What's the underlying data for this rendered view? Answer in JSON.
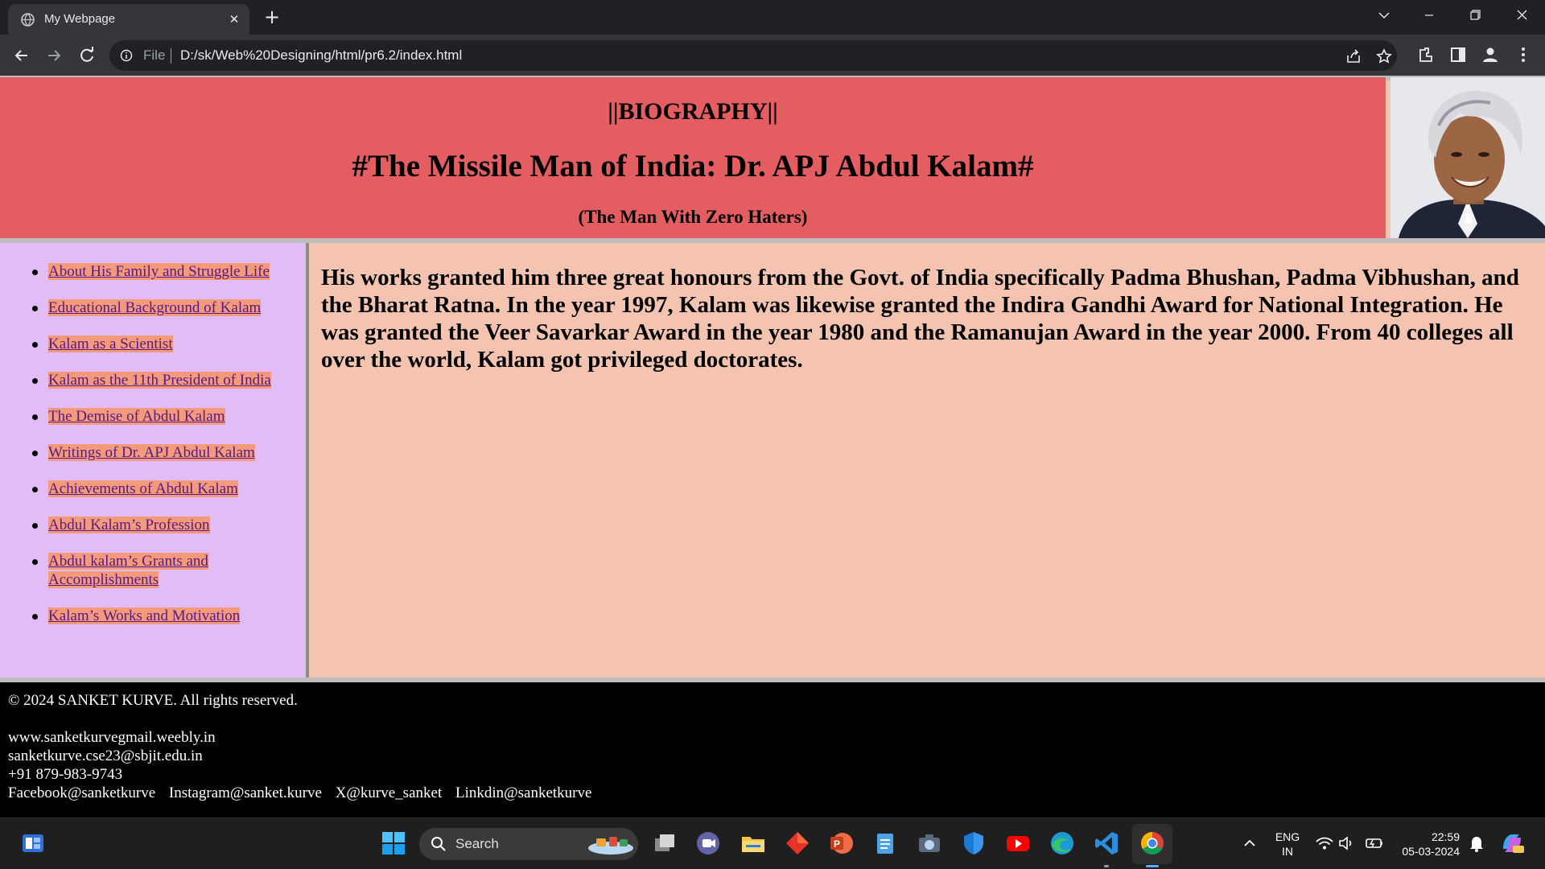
{
  "browser": {
    "tab_title": "My Webpage",
    "tab_close": "✕",
    "new_tab": "+",
    "url_scheme": "File",
    "url": "D:/sk/Web%20Designing/html/pr6.2/index.html"
  },
  "header": {
    "subtitle": "||BIOGRAPHY||",
    "title": "#The Missile Man of India: Dr. APJ Abdul Kalam#",
    "tagline": "(The Man With Zero Haters)"
  },
  "sidebar": {
    "links": [
      "About His Family and Struggle Life",
      "Educational Background of Kalam",
      "Kalam as a Scientist",
      "Kalam as the 11th President of India",
      "The Demise of Abdul Kalam",
      "Writings of Dr. APJ Abdul Kalam",
      "Achievements of Abdul Kalam",
      "Abdul Kalam’s Profession",
      "Abdul kalam’s Grants and Accomplishments",
      "Kalam’s Works and Motivation"
    ]
  },
  "main": {
    "text": "His works granted him three great honours from the Govt. of India specifically Padma Bhushan, Padma Vibhushan, and the Bharat Ratna. In the year 1997, Kalam was likewise granted the Indira Gandhi Award for National Integration. He was granted the Veer Savarkar Award in the year 1980 and the Ramanujan Award in the year 2000. From 40 colleges all over the world, Kalam got privileged doctorates."
  },
  "footer": {
    "copyright": "© 2024 SANKET KURVE. All rights reserved.",
    "website": "www.sanketkurvegmail.weebly.in",
    "email": "sanketkurve.cse23@sbjit.edu.in",
    "phone": "+91 879-983-9743",
    "social": {
      "facebook": "Facebook@sanketkurve",
      "instagram": "Instagram@sanket.kurve",
      "x": "X@kurve_sanket",
      "linkedin": "Linkdin@sanketkurve"
    }
  },
  "taskbar": {
    "search_label": "Search",
    "language": "ENG",
    "region": "IN",
    "time": "22:59",
    "date": "05-03-2024"
  },
  "icons": {
    "tab": "globe-icon",
    "nav": [
      "back-icon",
      "forward-icon",
      "reload-icon"
    ],
    "omnibox": [
      "info-icon",
      "share-icon",
      "star-icon"
    ],
    "toolbar": [
      "extensions-icon",
      "side-panel-icon",
      "profile-icon",
      "menu-icon"
    ],
    "taskbar": [
      "widgets-icon",
      "windows-start-icon",
      "search-icon",
      "task-view-icon",
      "teams-icon",
      "file-explorer-icon",
      "app-icon",
      "powerpoint-icon",
      "notepad-icon",
      "camera-icon",
      "security-icon",
      "youtube-icon",
      "edge-icon",
      "vscode-icon",
      "chrome-icon"
    ]
  },
  "colors": {
    "header_bg": "#e35d61",
    "sidebar_bg": "#e2bcf6",
    "main_bg": "#f4c4b0",
    "link_highlight": "#f49a7a",
    "link_text": "#551a8b",
    "footer_bg": "#000000"
  }
}
